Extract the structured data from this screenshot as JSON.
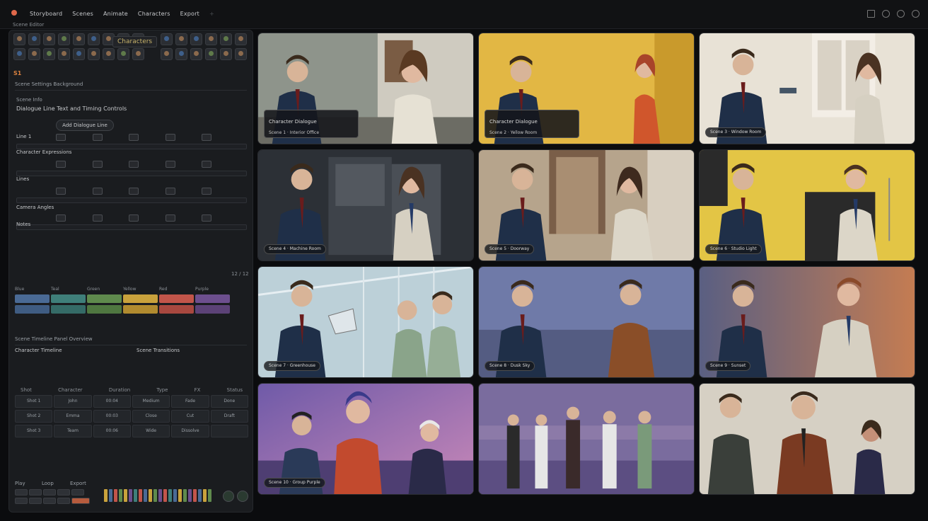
{
  "app": {
    "menu": [
      "Storyboard",
      "Scenes",
      "Animate",
      "Characters",
      "Export"
    ],
    "breadcrumb": "Scene Editor"
  },
  "panel": {
    "character_pill": "Characters",
    "orange_chip": "S1",
    "section1": "Scene Settings Background",
    "section1_sub": "Scene Info",
    "row_header": "Dialogue Line Text and Timing Controls",
    "pill_button": "Add Dialogue Line",
    "rows": [
      {
        "label": "Line 1"
      },
      {
        "label": "Character Expressions"
      },
      {
        "label": "Lines"
      },
      {
        "label": "Camera Angles"
      },
      {
        "label": "Notes"
      }
    ],
    "count_text": "12 / 12",
    "swatch_labels": [
      "Blue",
      "Teal",
      "Green",
      "Yellow",
      "Red",
      "Purple"
    ],
    "swatch_colors": [
      "#4a6a95",
      "#3f7f7a",
      "#5f8a4d",
      "#c9a23c",
      "#c2554a",
      "#6d4f8e"
    ],
    "timeline_title": "Scene Timeline Panel Overview",
    "legend_left": "Character Timeline",
    "legend_right": "Scene Transitions",
    "table_headers": [
      "Shot",
      "Character",
      "Duration",
      "Type",
      "FX",
      "Status"
    ],
    "table_rows": [
      [
        "Shot 1",
        "John",
        "00:04",
        "Medium",
        "Fade",
        "Done"
      ],
      [
        "Shot 2",
        "Emma",
        "00:03",
        "Close",
        "Cut",
        "Draft"
      ],
      [
        "Shot 3",
        "Team",
        "00:06",
        "Wide",
        "Dissolve",
        ""
      ]
    ],
    "bottom_labels": [
      "Play",
      "Loop",
      "Export"
    ]
  },
  "scenes": [
    {
      "dialog_title": "Character Dialogue",
      "dialog_sub": "Scene 1 · Interior Office",
      "caption": ""
    },
    {
      "dialog_title": "Character Dialogue",
      "dialog_sub": "Scene 2 · Yellow Room",
      "caption": ""
    },
    {
      "dialog_title": "",
      "dialog_sub": "",
      "caption": "Scene 3 · Window Room"
    },
    {
      "dialog_title": "",
      "dialog_sub": "",
      "caption": "Scene 4 · Machine Room"
    },
    {
      "dialog_title": "",
      "dialog_sub": "",
      "caption": "Scene 5 · Doorway"
    },
    {
      "dialog_title": "",
      "dialog_sub": "",
      "caption": "Scene 6 · Studio Light"
    },
    {
      "dialog_title": "",
      "dialog_sub": "",
      "caption": "Scene 7 · Greenhouse"
    },
    {
      "dialog_title": "",
      "dialog_sub": "",
      "caption": "Scene 8 · Dusk Sky"
    },
    {
      "dialog_title": "",
      "dialog_sub": "",
      "caption": "Scene 9 · Sunset"
    },
    {
      "dialog_title": "",
      "dialog_sub": "",
      "caption": "Scene 10 · Group Purple"
    },
    {
      "dialog_title": "",
      "dialog_sub": "",
      "caption": ""
    },
    {
      "dialog_title": "",
      "dialog_sub": "",
      "caption": ""
    }
  ],
  "colors": {
    "accent": "#d9813f",
    "panel_bg": "#1a1c1f",
    "page_bg": "#0b0c0e"
  }
}
